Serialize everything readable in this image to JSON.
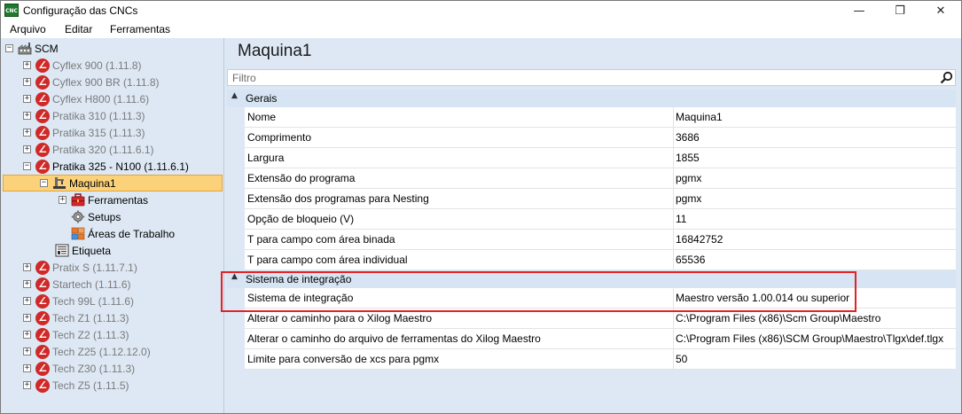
{
  "window": {
    "app_icon_label": "CNC",
    "title": "Configuração das CNCs",
    "minimize_glyph": "—",
    "restore_glyph": "❐",
    "close_glyph": "✕"
  },
  "menu": {
    "items": [
      {
        "label": "Arquivo"
      },
      {
        "label": "Editar"
      },
      {
        "label": "Ferramentas"
      }
    ]
  },
  "tree": {
    "root": {
      "label": "SCM",
      "expander": "−"
    },
    "cnc_icon_glyph": "∠",
    "machines": [
      {
        "label": "Cyflex 900 (1.11.8)",
        "expander": "+"
      },
      {
        "label": "Cyflex 900 BR (1.11.8)",
        "expander": "+"
      },
      {
        "label": "Cyflex H800 (1.11.6)",
        "expander": "+"
      },
      {
        "label": "Pratika 310 (1.11.3)",
        "expander": "+"
      },
      {
        "label": "Pratika 315 (1.11.3)",
        "expander": "+"
      },
      {
        "label": "Pratika 320 (1.11.6.1)",
        "expander": "+"
      },
      {
        "label": "Pratika 325 - N100 (1.11.6.1)",
        "expander": "−"
      }
    ],
    "selected": {
      "label": "Maquina1",
      "expander": "−"
    },
    "children": [
      {
        "label": "Ferramentas",
        "expander": "+"
      },
      {
        "label": "Setups"
      },
      {
        "label": "Áreas de Trabalho"
      }
    ],
    "etiqueta": {
      "label": "Etiqueta"
    },
    "machines_after": [
      {
        "label": "Pratix S (1.11.7.1)",
        "expander": "+"
      },
      {
        "label": "Startech (1.11.6)",
        "expander": "+"
      },
      {
        "label": "Tech 99L (1.11.6)",
        "expander": "+"
      },
      {
        "label": "Tech Z1 (1.11.3)",
        "expander": "+"
      },
      {
        "label": "Tech Z2 (1.11.3)",
        "expander": "+"
      },
      {
        "label": "Tech Z25 (1.12.12.0)",
        "expander": "+"
      },
      {
        "label": "Tech Z30 (1.11.3)",
        "expander": "+"
      },
      {
        "label": "Tech Z5 (1.11.5)",
        "expander": "+"
      }
    ]
  },
  "panel": {
    "title": "Maquina1",
    "filter_placeholder": "Filtro",
    "collapse_glyph": "▲",
    "sections": [
      {
        "label": "Gerais",
        "rows": [
          {
            "name": "Nome",
            "value": "Maquina1"
          },
          {
            "name": "Comprimento",
            "value": "3686"
          },
          {
            "name": "Largura",
            "value": "1855"
          },
          {
            "name": "Extensão do programa",
            "value": "pgmx"
          },
          {
            "name": "Extensão dos programas para Nesting",
            "value": "pgmx"
          },
          {
            "name": "Opção de bloqueio (V)",
            "value": "11"
          },
          {
            "name": "T para campo com área binada",
            "value": "16842752"
          },
          {
            "name": "T para campo com área individual",
            "value": "65536"
          }
        ]
      },
      {
        "label": "Sistema de integração",
        "rows": [
          {
            "name": "Sistema de integração",
            "value": "Maestro versão 1.00.014 ou superior"
          },
          {
            "name": "Alterar o caminho para o Xilog Maestro",
            "value": "C:\\Program Files (x86)\\Scm Group\\Maestro"
          },
          {
            "name": "Alterar o caminho do arquivo de ferramentas do Xilog Maestro",
            "value": "C:\\Program Files (x86)\\SCM Group\\Maestro\\Tlgx\\def.tlgx"
          },
          {
            "name": "Limite para conversão de xcs para pgmx",
            "value": "50"
          }
        ]
      }
    ]
  },
  "colors": {
    "accent_red": "#e32227",
    "selection": "#fbd27a",
    "pane_background": "#dde8f4"
  }
}
